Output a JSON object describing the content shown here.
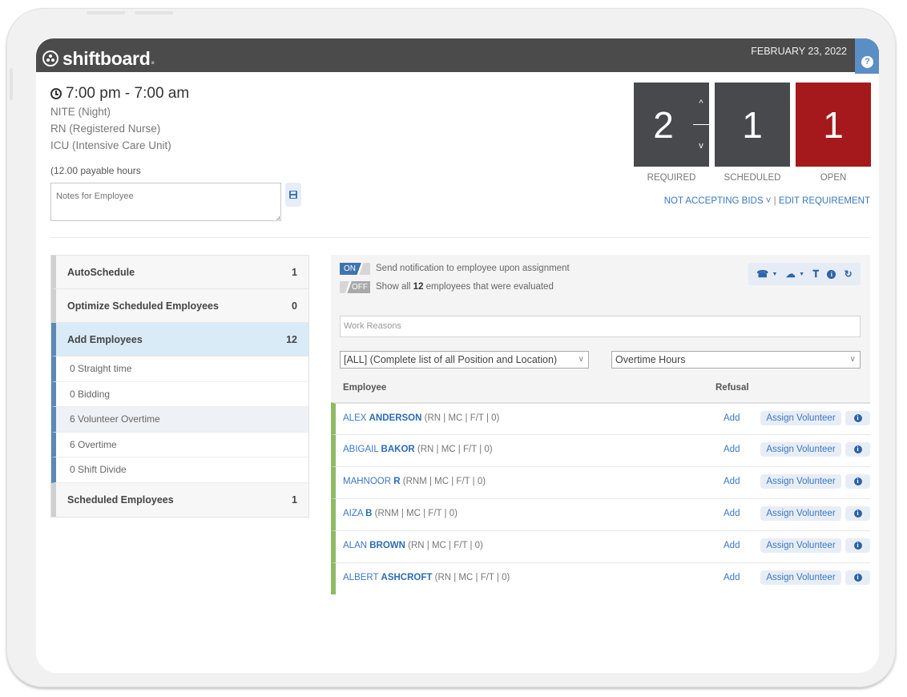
{
  "app": {
    "brand": "shiftboard",
    "date": "FEBRUARY 23, 2022",
    "help_icon": "question-circle-icon"
  },
  "shift": {
    "time": "7:00 pm - 7:00 am",
    "schedule": "NITE (Night)",
    "position": "RN (Registered Nurse)",
    "location": "ICU (Intensive Care Unit)",
    "payable": "(12.00 payable hours",
    "notes_placeholder": "Notes for Employee",
    "notes_value": ""
  },
  "counts": {
    "required": {
      "value": "2",
      "label": "REQUIRED"
    },
    "scheduled": {
      "value": "1",
      "label": "SCHEDULED"
    },
    "open": {
      "value": "1",
      "label": "OPEN"
    },
    "step_up": "^",
    "step_down": "v"
  },
  "requirement_links": {
    "bids": "NOT ACCEPTING BIDS ˅",
    "separator": "|",
    "edit": "EDIT REQUIREMENT"
  },
  "left_panel": {
    "autoschedule": {
      "label": "AutoSchedule",
      "count": "1"
    },
    "optimize": {
      "label": "Optimize Scheduled Employees",
      "count": "0"
    },
    "add_employees": {
      "label": "Add Employees",
      "count": "12"
    },
    "sub_items": [
      {
        "label": "0 Straight time"
      },
      {
        "label": "0 Bidding"
      },
      {
        "label": "6 Volunteer Overtime"
      },
      {
        "label": "6 Overtime"
      },
      {
        "label": "0 Shift Divide"
      }
    ],
    "scheduled": {
      "label": "Scheduled Employees",
      "count": "1"
    }
  },
  "options": {
    "notify": {
      "state": "ON",
      "text": "Send notification to employee upon assignment"
    },
    "show_all": {
      "state": "OFF",
      "prefix": "Show all ",
      "count": "12",
      "suffix": " employees that were evaluated"
    }
  },
  "toolbar": {
    "icons": [
      "phone-icon",
      "caret-down-icon",
      "cloud-icon",
      "caret-down-icon",
      "filter-icon",
      "info-icon",
      "refresh-icon"
    ]
  },
  "filters": {
    "work_reasons_placeholder": "Work Reasons",
    "position_select": "[ALL] (Complete list of all Position and Location)",
    "sort_select": "Overtime Hours"
  },
  "table": {
    "headers": {
      "employee": "Employee",
      "refusal": "Refusal"
    },
    "rows": [
      {
        "first": "ALEX",
        "last": "ANDERSON",
        "meta": " (RN | MC | F/T | 0)",
        "add": "Add",
        "assign": "Assign Volunteer"
      },
      {
        "first": "ABIGAIL",
        "last": "BAKOR",
        "meta": " (RN | MC | F/T | 0)",
        "add": "Add",
        "assign": "Assign Volunteer"
      },
      {
        "first": "MAHNOOR",
        "last": "R",
        "meta": " (RNM | MC | F/T | 0)",
        "add": "Add",
        "assign": "Assign Volunteer"
      },
      {
        "first": "AIZA",
        "last": "B",
        "meta": " (RNM | MC | F/T | 0)",
        "add": "Add",
        "assign": "Assign Volunteer"
      },
      {
        "first": "ALAN",
        "last": "BROWN",
        "meta": " (RN | MC | F/T | 0)",
        "add": "Add",
        "assign": "Assign Volunteer"
      },
      {
        "first": "ALBERT",
        "last": "ASHCROFT",
        "meta": " (RN | MC | F/T | 0)",
        "add": "Add",
        "assign": "Assign Volunteer"
      }
    ]
  },
  "colors": {
    "topbar": "#4b4b4c",
    "help_tab": "#5b8ec4",
    "count_dark": "#48494d",
    "count_open": "#a5181b",
    "link": "#3a78c2",
    "active_row": "#d9ebf6",
    "row_status": "#8fba64"
  }
}
